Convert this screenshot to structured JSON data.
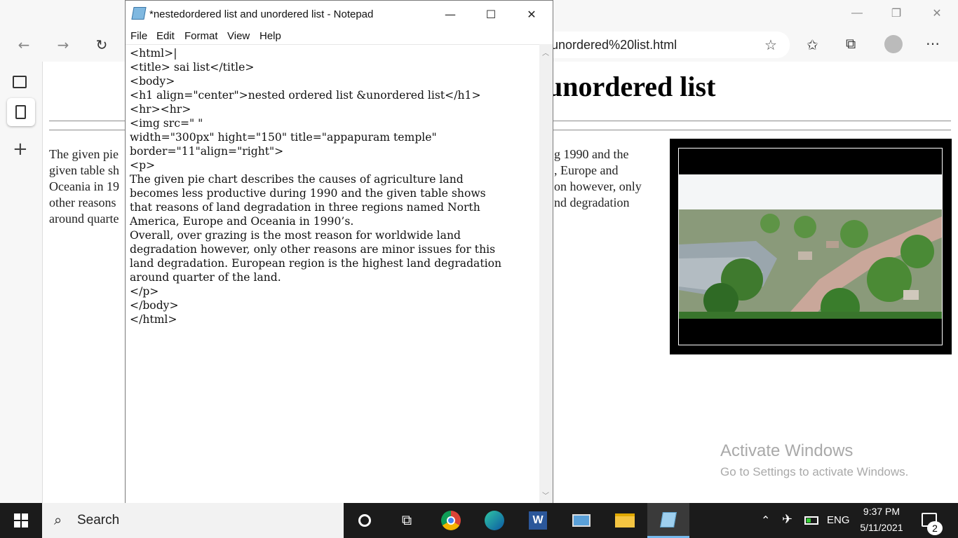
{
  "browser": {
    "address": "unordered%20list.html",
    "page_heading": "unordered list",
    "paragraph_left": [
      "The given pie",
      "given table sh",
      "Oceania in 19",
      "other reasons",
      "around quarte"
    ],
    "paragraph_right": [
      "g 1990 and the",
      ", Europe and",
      "on however, only",
      "nd degradation"
    ]
  },
  "notepad": {
    "title": "*nestedordered list and unordered list - Notepad",
    "menu": [
      "File",
      "Edit",
      "Format",
      "View",
      "Help"
    ],
    "code_lines": [
      "<html>|",
      "<title> sai list</title>",
      "<body>",
      "<h1 align=\"center\">nested ordered list &unordered list</h1>",
      "<hr><hr>",
      "<img src=\" \"",
      "width=\"300px\" hight=\"150\" title=\"appapuram temple\"",
      "border=\"11\"align=\"right\">",
      "<p>",
      "The given pie chart describes the causes of agriculture land",
      "becomes less productive during 1990 and the given table shows",
      "that reasons of land degradation in three regions named North",
      "America, Europe and Oceania in 1990’s.",
      "Overall, over grazing is the most reason for worldwide land",
      "degradation however, only other reasons are minor issues for this",
      "land degradation. European region is the highest land degradation",
      "around quarter of the land.",
      "</p>",
      "</body>",
      "</html>"
    ]
  },
  "watermark": {
    "line1": "Activate Windows",
    "line2": "Go to Settings to activate Windows."
  },
  "taskbar": {
    "search_label": "Search",
    "language": "ENG",
    "time": "9:37 PM",
    "date": "5/11/2021",
    "notifications": "2"
  },
  "colors": {
    "taskbar": "#1b1b1b",
    "accent": "#0078d7"
  }
}
